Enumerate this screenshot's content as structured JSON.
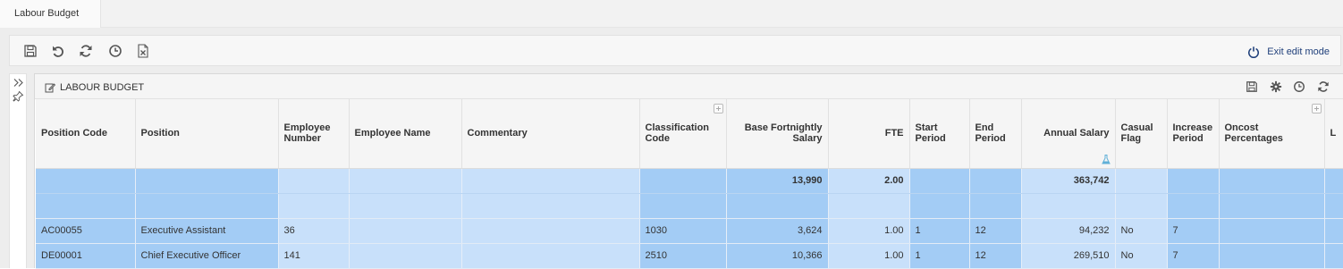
{
  "tabs": [
    {
      "label": "Labour Budget",
      "active": true
    }
  ],
  "toolbar": {
    "icons": [
      "save-icon",
      "undo-icon",
      "refresh-icon",
      "history-icon",
      "excel-export-icon"
    ],
    "exit_label": "Exit edit mode"
  },
  "panel": {
    "title": "LABOUR BUDGET",
    "header_icons": [
      "save-icon",
      "gear-icon",
      "history-icon",
      "refresh-icon"
    ]
  },
  "grid": {
    "columns": [
      {
        "label": "Position Code",
        "align": "left"
      },
      {
        "label": "Position",
        "align": "left"
      },
      {
        "label": "Employee Number",
        "align": "left"
      },
      {
        "label": "Employee Name",
        "align": "left"
      },
      {
        "label": "Commentary",
        "align": "left"
      },
      {
        "label": "Classification Code",
        "align": "left"
      },
      {
        "label": "Base Fortnightly Salary",
        "align": "right"
      },
      {
        "label": "FTE",
        "align": "right"
      },
      {
        "label": "Start Period",
        "align": "left"
      },
      {
        "label": "End Period",
        "align": "left"
      },
      {
        "label": "Annual Salary",
        "align": "right"
      },
      {
        "label": "Casual Flag",
        "align": "left"
      },
      {
        "label": "Increase Period",
        "align": "left"
      },
      {
        "label": "Oncost Percentages",
        "align": "left"
      },
      {
        "label": "L",
        "align": "left"
      }
    ],
    "total_row": [
      "",
      "",
      "",
      "",
      "",
      "",
      "13,990",
      "2.00",
      "",
      "",
      "363,742",
      "",
      "",
      "",
      ""
    ],
    "blank_row": [
      "",
      "",
      "",
      "",
      "",
      "",
      "",
      "",
      "",
      "",
      "",
      "",
      "",
      "",
      ""
    ],
    "rows": [
      [
        "AC00055",
        "Executive Assistant",
        "36",
        "",
        "",
        "1030",
        "3,624",
        "1.00",
        "1",
        "12",
        "94,232",
        "No",
        "7",
        "",
        ""
      ],
      [
        "DE00001",
        "Chief Executive Officer",
        "141",
        "",
        "",
        "2510",
        "10,366",
        "1.00",
        "1",
        "12",
        "269,510",
        "No",
        "7",
        "",
        ""
      ]
    ]
  },
  "colors": {
    "row_dark": "#a3ccf5",
    "row_light": "#c8e0fa",
    "accent": "#1f3f7a"
  }
}
